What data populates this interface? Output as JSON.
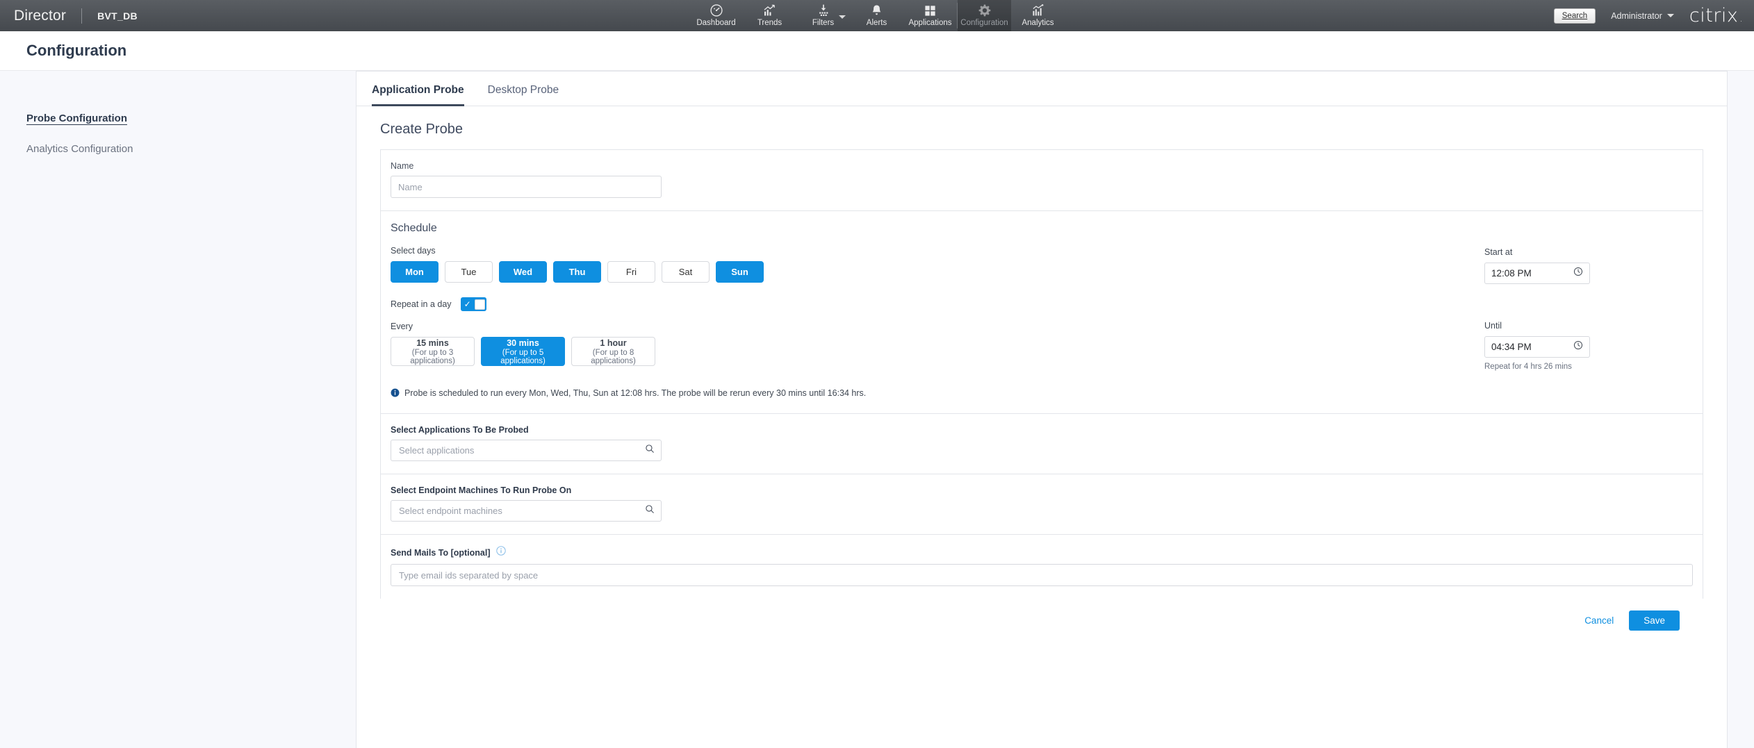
{
  "topnav": {
    "brand": "Director",
    "database": "BVT_DB",
    "items": [
      {
        "label": "Dashboard",
        "icon": "dashboard-gauge-icon",
        "active": false,
        "dim": false
      },
      {
        "label": "Trends",
        "icon": "trends-chart-icon",
        "active": false,
        "dim": false
      },
      {
        "label": "Filters",
        "icon": "filters-funnel-icon",
        "active": false,
        "dim": false,
        "caret": true
      },
      {
        "label": "Alerts",
        "icon": "alerts-bell-icon",
        "active": false,
        "dim": false
      },
      {
        "label": "Applications",
        "icon": "applications-grid-icon",
        "active": false,
        "dim": false
      },
      {
        "label": "Configuration",
        "icon": "configuration-gear-icon",
        "active": true,
        "dim": true
      },
      {
        "label": "Analytics",
        "icon": "analytics-chart-icon",
        "active": false,
        "dim": false
      }
    ],
    "search_label": "Search",
    "search_accesskey": "S",
    "admin_label": "Administrator",
    "logo": "citrix"
  },
  "page": {
    "title": "Configuration"
  },
  "sidebar": {
    "items": [
      {
        "label": "Probe Configuration",
        "active": true
      },
      {
        "label": "Analytics Configuration",
        "active": false
      }
    ]
  },
  "tabs": [
    {
      "label": "Application Probe",
      "active": true
    },
    {
      "label": "Desktop Probe",
      "active": false
    }
  ],
  "form": {
    "heading": "Create Probe",
    "name": {
      "label": "Name",
      "value": "",
      "placeholder": "Name"
    },
    "schedule": {
      "title": "Schedule",
      "select_days_label": "Select days",
      "days": [
        {
          "label": "Mon",
          "selected": true
        },
        {
          "label": "Tue",
          "selected": false
        },
        {
          "label": "Wed",
          "selected": true
        },
        {
          "label": "Thu",
          "selected": true
        },
        {
          "label": "Fri",
          "selected": false
        },
        {
          "label": "Sat",
          "selected": false
        },
        {
          "label": "Sun",
          "selected": true
        }
      ],
      "repeat_label": "Repeat in a day",
      "repeat_enabled": true,
      "every_label": "Every",
      "intervals": [
        {
          "title": "15 mins",
          "subtitle": "(For up to 3 applications)",
          "selected": false
        },
        {
          "title": "30 mins",
          "subtitle": "(For up to 5 applications)",
          "selected": true
        },
        {
          "title": "1 hour",
          "subtitle": "(For up to 8 applications)",
          "selected": false
        }
      ],
      "start_at_label": "Start at",
      "start_at_value": "12:08 PM",
      "until_label": "Until",
      "until_value": "04:34 PM",
      "repeat_hint": "Repeat for 4 hrs 26 mins",
      "info_message": "Probe is scheduled to run every Mon, Wed, Thu, Sun at 12:08 hrs. The probe will be rerun every 30 mins until 16:34 hrs."
    },
    "applications": {
      "label": "Select Applications To Be Probed",
      "placeholder": "Select applications",
      "value": ""
    },
    "endpoints": {
      "label": "Select Endpoint Machines To Run Probe On",
      "placeholder": "Select endpoint machines",
      "value": ""
    },
    "mails": {
      "label": "Send Mails To [optional]",
      "placeholder": "Type email ids separated by space",
      "value": ""
    },
    "cancel_label": "Cancel",
    "save_label": "Save"
  },
  "colors": {
    "accent_blue": "#0f8fe0",
    "header_dark": "#4e5257",
    "text_dark": "#2e3b4e"
  }
}
